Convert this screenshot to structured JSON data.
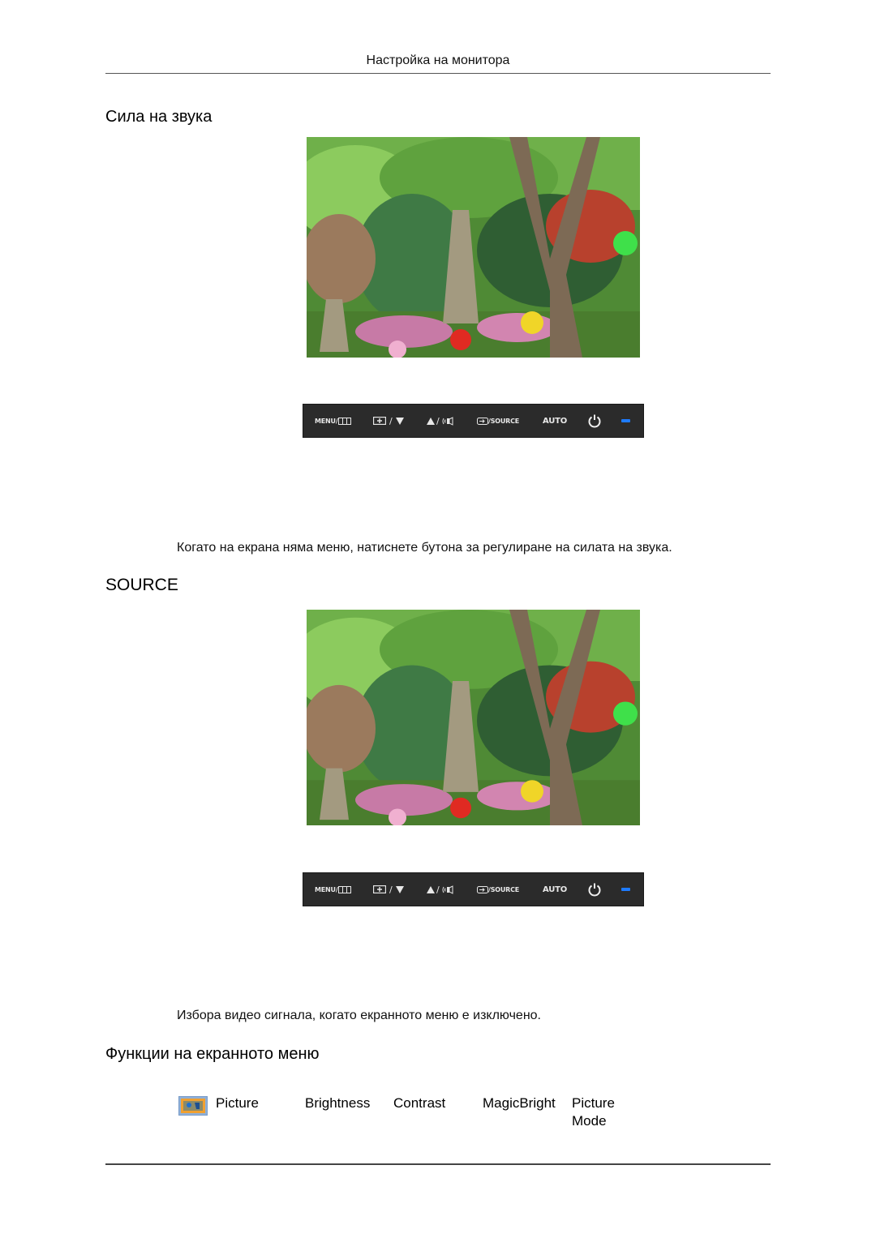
{
  "header": {
    "running_title": "Настройка на монитора"
  },
  "sections": [
    {
      "heading": "Сила на звука",
      "image_alt": "garden-with-pagodas-and-lanterns-photo",
      "description": "Когато на екрана няма меню, натиснете бутона за регулиране на силата на звука."
    },
    {
      "heading": "SOURCE",
      "image_alt": "garden-with-pagodas-and-lanterns-photo",
      "description": "Избора видео сигнала, когато екранното меню е изключено."
    },
    {
      "heading": "Функции на екранното меню"
    }
  ],
  "control_panel": {
    "buttons": [
      {
        "label": "MENU/",
        "icon": "menu-grid-icon"
      },
      {
        "label": "/",
        "icon": "brightness-down-icon"
      },
      {
        "label": "/",
        "icon": "volume-up-icon"
      },
      {
        "label": "/SOURCE",
        "icon": "source-input-icon"
      },
      {
        "label": "AUTO",
        "icon": ""
      },
      {
        "label": "",
        "icon": "power-icon"
      },
      {
        "label": "",
        "icon": "power-led-indicator"
      }
    ],
    "led_color": "#1e7bff"
  },
  "osd_menu": {
    "icon": "picture-icon",
    "items": [
      "Picture",
      "Brightness",
      "Contrast",
      "MagicBright",
      "Picture Mode"
    ]
  }
}
